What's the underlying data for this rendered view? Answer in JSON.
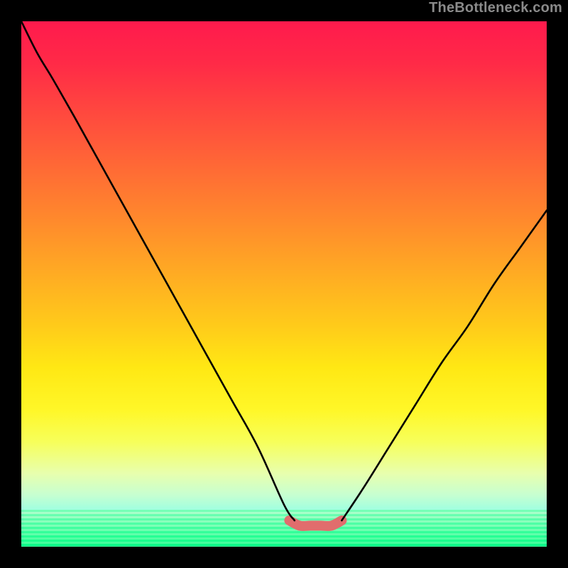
{
  "watermark": "TheBottleneck.com",
  "colors": {
    "frame": "#000000",
    "curve": "#000000",
    "highlight": "#e16d6d"
  },
  "chart_data": {
    "type": "line",
    "title": "",
    "xlabel": "",
    "ylabel": "",
    "xlim": [
      0,
      100
    ],
    "ylim": [
      0,
      100
    ],
    "grid": false,
    "legend": false,
    "annotations": [
      {
        "text": "TheBottleneck.com",
        "position": "top-right"
      }
    ],
    "series": [
      {
        "name": "left-branch",
        "x": [
          0,
          3,
          6,
          10,
          15,
          20,
          25,
          30,
          35,
          40,
          45,
          50,
          52
        ],
        "values": [
          100,
          94,
          89,
          82,
          73,
          64,
          55,
          46,
          37,
          28,
          19,
          8,
          5
        ]
      },
      {
        "name": "valley-highlight",
        "x": [
          51,
          53,
          55,
          57,
          59,
          61
        ],
        "values": [
          5,
          4,
          4,
          4,
          4,
          5
        ]
      },
      {
        "name": "right-branch",
        "x": [
          61,
          65,
          70,
          75,
          80,
          85,
          90,
          95,
          100
        ],
        "values": [
          5,
          11,
          19,
          27,
          35,
          42,
          50,
          57,
          64
        ]
      }
    ],
    "background_gradient": {
      "orientation": "vertical",
      "stops": [
        {
          "pos": 0.0,
          "color": "#ff1a4d"
        },
        {
          "pos": 0.5,
          "color": "#ffcb1a"
        },
        {
          "pos": 0.8,
          "color": "#f7ff5a"
        },
        {
          "pos": 1.0,
          "color": "#0aff84"
        }
      ]
    }
  }
}
